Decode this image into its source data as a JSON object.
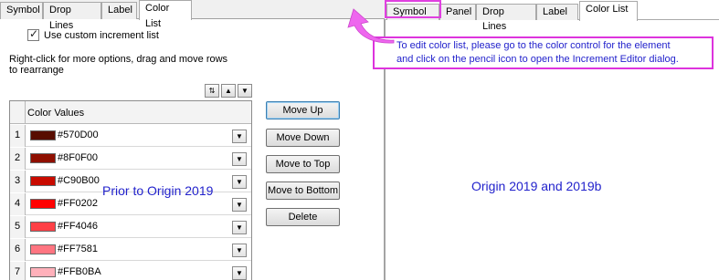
{
  "prior_dialog": {
    "tabs": [
      "Symbol",
      "Drop Lines",
      "Label",
      "Color List"
    ],
    "checkbox_label": "Use custom increment list",
    "checkbox_checked": true,
    "hint": "Right-click for more options, drag and move rows to  rearrange",
    "grid": {
      "column_header": "Color Values",
      "rows": [
        {
          "num": "1",
          "hex": "#570D00",
          "color": "#570D00"
        },
        {
          "num": "2",
          "hex": "#8F0F00",
          "color": "#8F0F00"
        },
        {
          "num": "3",
          "hex": "#C90B00",
          "color": "#C90B00"
        },
        {
          "num": "4",
          "hex": "#FF0202",
          "color": "#FF0202"
        },
        {
          "num": "5",
          "hex": "#FF4046",
          "color": "#FF4046"
        },
        {
          "num": "6",
          "hex": "#FF7581",
          "color": "#FF7581"
        },
        {
          "num": "7",
          "hex": "#FFB0BA",
          "color": "#FFB0BA"
        }
      ]
    },
    "buttons": {
      "move_up": "Move Up",
      "move_down": "Move Down",
      "move_top": "Move to Top",
      "move_bottom": "Move to Bottom",
      "delete": "Delete"
    },
    "overlay_label": "Prior to Origin 2019"
  },
  "new_dialog": {
    "tabs": [
      "Symbol",
      "Panel",
      "Drop Lines",
      "Label",
      "Color List"
    ],
    "callout_line1": "To edit color list, please go to the color control for the element",
    "callout_line2": "and click on the pencil icon to open the Increment Editor dialog.",
    "overlay_label": "Origin 2019 and 2019b"
  },
  "colors": {
    "annotation_text": "#2222CC",
    "highlight_border": "#DD33DD",
    "arrow_fill": "#EE66EE"
  }
}
